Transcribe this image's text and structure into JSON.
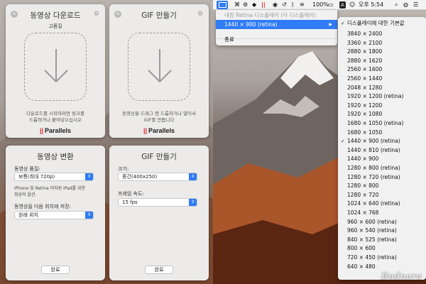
{
  "panels": {
    "download": {
      "title": "동영상 다운로드",
      "quality_label": "고품질",
      "hint_line1": "다운로드를 시작하려면 링크를",
      "hint_line2": "드롭하거나 붙여넣으십시오",
      "brand": "Parallels"
    },
    "gif": {
      "title": "GIF 만들기",
      "hint_line1": "동영상을 드래그 앤 드롭하거나 열어서",
      "hint_line2": "GIF를 만듭니다",
      "brand": "Parallels"
    },
    "convert": {
      "title": "동영상 변환",
      "quality_label": "동영상 품질:",
      "quality_value": "보통(최대 720p)",
      "note_line1": "iPhone 및 Retina 미지원 iPad를 위한",
      "note_line2": "최상의 옵션.",
      "save_label": "동영상을 다음 위치에 저장:",
      "save_value": "원래 위치",
      "done_label": "완료"
    },
    "gif_settings": {
      "title": "GIF 만들기",
      "size_label": "크기:",
      "size_value": "중간(400x250)",
      "fps_label": "프레임 속도:",
      "fps_value": "15 fps",
      "done_label": "완료"
    }
  },
  "menubar": {
    "battery": "100%",
    "input_indicator": "A",
    "clock": "오후 5:54"
  },
  "display_menu": {
    "internal_label": "내장 Retina 디스플레이 (이 디스플레이)",
    "current_resolution": "1440 × 900 (retina)",
    "end_label": "종료"
  },
  "resolution_menu": {
    "default_label": "디스플레이에 대한 기본값",
    "items": [
      "3840 × 2400",
      "3360 × 2100",
      "2880 × 1800",
      "2880 × 1620",
      "2560 × 1600",
      "2560 × 1440",
      "2048 × 1280",
      "1920 × 1200 (retina)",
      "1920 × 1200",
      "1920 × 1080",
      "1680 × 1050 (retina)",
      "1680 × 1050",
      "1440 × 900 (retina)",
      "1440 × 810 (retina)",
      "1440 × 900",
      "1280 × 800 (retina)",
      "1280 × 720 (retina)",
      "1280 × 800",
      "1280 × 720",
      "1024 × 640 (retina)",
      "1024 × 768",
      "960 × 600 (retina)",
      "960 × 540 (retina)",
      "840 × 525 (retina)",
      "800 × 600",
      "720 × 450 (retina)",
      "640 × 480"
    ],
    "checked_index": 12
  },
  "watermark": "Bodnara",
  "colors": {
    "accent": "#2f7cf6",
    "brand_red": "#e0262b"
  }
}
